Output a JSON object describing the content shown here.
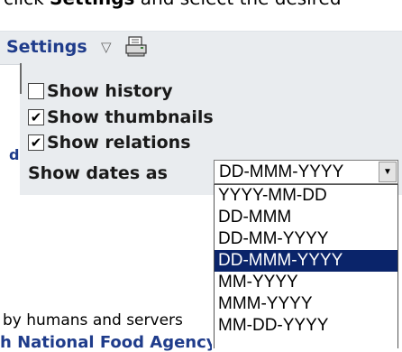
{
  "top_text": {
    "prefix": "click ",
    "bold": "Settings",
    "suffix": " and select the desired"
  },
  "settings": {
    "label": "Settings",
    "arrow": "▽",
    "print_icon": "printer-icon"
  },
  "panel": {
    "side_letter": "d",
    "options": [
      {
        "label": "Show history",
        "checked": false
      },
      {
        "label": "Show thumbnails",
        "checked": true
      },
      {
        "label": "Show relations",
        "checked": true
      }
    ],
    "dates_label": "Show dates as",
    "dates_value": "DD-MMM-YYYY",
    "dropdown_arrow": "▼",
    "dropdown_options": [
      "YYYY-MM-DD",
      "DD-MMM",
      "DD-MM-YYYY",
      "DD-MMM-YYYY",
      "MM-YYYY",
      "MMM-YYYY",
      "MM-DD-YYYY"
    ],
    "selected_index": 3
  },
  "page_text": {
    "line1": "by humans and servers",
    "line2": "h National Food Agency"
  }
}
